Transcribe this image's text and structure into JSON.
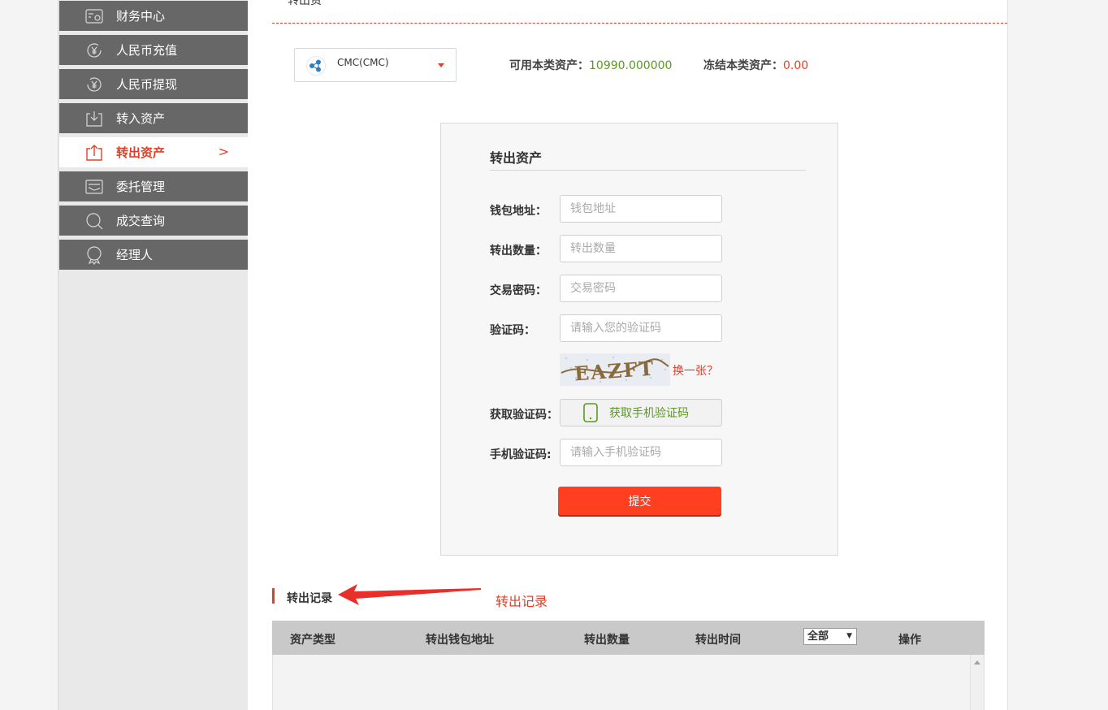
{
  "sidebar": {
    "items": [
      {
        "label": "财务中心",
        "icon": "wallet-icon"
      },
      {
        "label": "人民币充值",
        "icon": "yuan-recharge-icon"
      },
      {
        "label": "人民币提现",
        "icon": "yuan-withdraw-icon"
      },
      {
        "label": "转入资产",
        "icon": "transfer-in-icon"
      },
      {
        "label": "转出资产",
        "icon": "transfer-out-icon",
        "active": true,
        "chevron": ">"
      },
      {
        "label": "委托管理",
        "icon": "entrust-icon"
      },
      {
        "label": "成交查询",
        "icon": "search-icon"
      },
      {
        "label": "经理人",
        "icon": "manager-icon"
      }
    ]
  },
  "header": {
    "title_stub": "转出资"
  },
  "coin": {
    "name": "CMC(CMC)"
  },
  "assets": {
    "available_label": "可用本类资产：",
    "available_value": "10990.000000",
    "frozen_label": "冻结本类资产：",
    "frozen_value": "0.00"
  },
  "form": {
    "title": "转出资产",
    "wallet_label": "钱包地址：",
    "wallet_placeholder": "钱包地址",
    "amount_label": "转出数量：",
    "amount_placeholder": "转出数量",
    "password_label": "交易密码：",
    "password_placeholder": "交易密码",
    "captcha_label": "验证码：",
    "captcha_placeholder": "请输入您的验证码",
    "captcha_text": "EAZFT",
    "captcha_refresh": "换一张？",
    "sms_label": "获取验证码：",
    "sms_button": "获取手机验证码",
    "phone_code_label": "手机验证码:",
    "phone_code_placeholder": "请输入手机验证码",
    "submit": "提交"
  },
  "records": {
    "title": "转出记录",
    "annotation": "转出记录",
    "columns": [
      "资产类型",
      "转出钱包地址",
      "转出数量",
      "转出时间",
      "操作"
    ],
    "filter_value": "全部"
  },
  "colors": {
    "accent": "#e0402a",
    "green": "#5a9a1f",
    "sidebar": "#676767",
    "button": "#ff3f1f"
  }
}
